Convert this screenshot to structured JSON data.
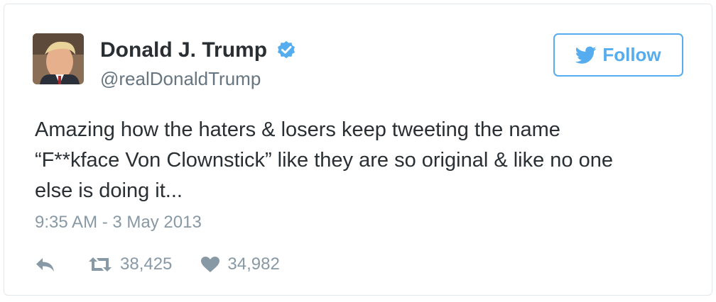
{
  "user": {
    "display_name": "Donald J. Trump",
    "handle": "@realDonaldTrump",
    "verified": true
  },
  "follow_button": {
    "label": "Follow"
  },
  "tweet": {
    "text": "Amazing how the haters & losers keep tweeting the name\n“F**kface Von Clownstick” like they are so original & like no one\nelse is doing it...",
    "timestamp": "9:35 AM - 3 May 2013"
  },
  "stats": {
    "retweets": "38,425",
    "likes": "34,982"
  },
  "colors": {
    "accent": "#55acee",
    "text": "#292f33",
    "muted": "#8899a6",
    "border": "#e1e8ed"
  },
  "icons": [
    "avatar-photo",
    "verified-badge-icon",
    "twitter-bird-icon",
    "reply-icon",
    "retweet-icon",
    "heart-icon"
  ]
}
